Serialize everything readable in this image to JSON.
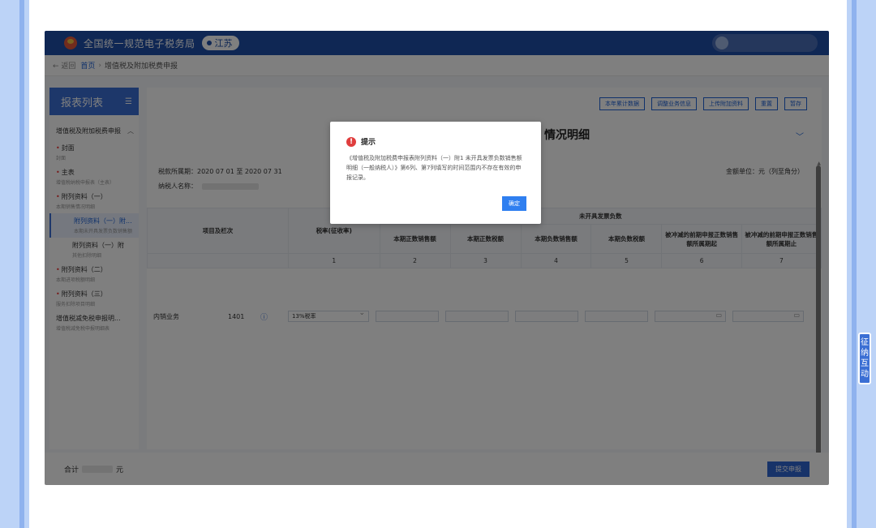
{
  "app": {
    "title": "全国统一规范电子税务局",
    "region": "江苏"
  },
  "breadcrumb": {
    "back": "← 返回",
    "home": "首页",
    "current": "增值税及附加税费申报"
  },
  "sidebar": {
    "header": "报表列表",
    "group": "增值税及附加税费申报",
    "items": [
      {
        "title": "封面",
        "sub": "封面",
        "required": true
      },
      {
        "title": "主表",
        "sub": "增值税纳税申报表（主表）",
        "required": true
      },
      {
        "title": "附列资料（一）",
        "sub": "本期销售情况明细",
        "required": true
      },
      {
        "title": "附列资料（一）附...",
        "sub": "本期未开具发票负数销售额",
        "required": false,
        "active": true
      },
      {
        "title": "附列资料（一）附",
        "sub": "其他扣除明细",
        "required": false
      },
      {
        "title": "附列资料（二）",
        "sub": "本期进项税额明细",
        "required": true
      },
      {
        "title": "附列资料（三）",
        "sub": "服务扣除项目明细",
        "required": true
      },
      {
        "title": "增值税减免税申报明...",
        "sub": "增值税减免税申报明细表",
        "required": false
      }
    ]
  },
  "toolbar": {
    "buttons": [
      "本年累计数据",
      "调整业务信息",
      "上传附加资料",
      "重置",
      "暂存"
    ]
  },
  "form": {
    "title": "情况明细",
    "period_label": "税款所属期：",
    "period_value": "2020 07 01 至 2020 07 31",
    "taxpayer_label": "纳税人名称：",
    "unit": "金额单位：元（列至角分）"
  },
  "table": {
    "group_header": "未开具发票负数",
    "headers": [
      "项目及栏次",
      "税率(征收率)",
      "本期正数销售额",
      "本期正数税额",
      "本期负数销售额",
      "本期负数税额",
      "被冲减的前期申报正数销售额所属期起",
      "被冲减的前期申报正数销售额所属期止"
    ],
    "indexes": [
      "1",
      "2",
      "3",
      "4",
      "5",
      "6",
      "7"
    ],
    "row": {
      "label": "内销业务",
      "code": "1401",
      "rate": "13%税率"
    }
  },
  "footer": {
    "total_label": "合计",
    "total_unit": "元",
    "submit": "提交申报"
  },
  "float_tab": "征纳互动",
  "modal": {
    "title": "提示",
    "message": "《增值税及附加税费申报表附列资料（一）附1 未开具发票负数销售额明细（一般纳税人）》第6列、第7列填写的时间范围内不存在有效的申报记录。",
    "confirm": "确定"
  },
  "colors": {
    "brand": "#1f4fa8",
    "accent": "#3b6fd4",
    "warning": "#e03e3e",
    "frame": "#bcd3f7"
  }
}
